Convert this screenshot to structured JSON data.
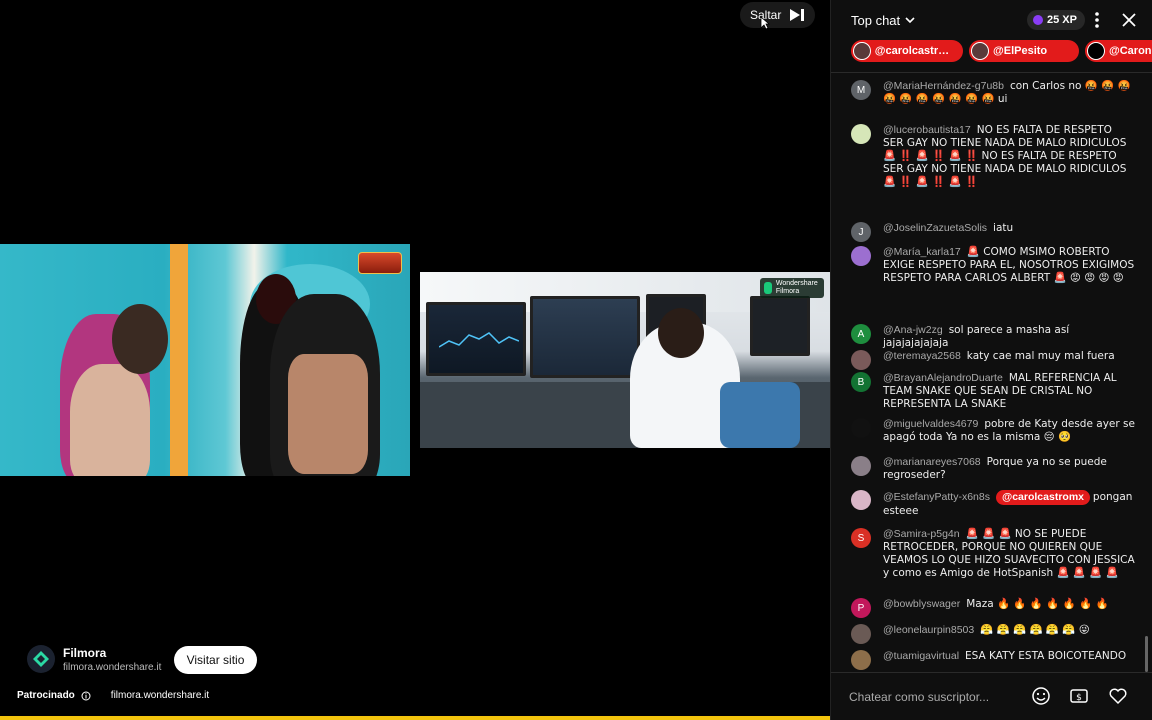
{
  "video": {
    "skip_label": "Saltar",
    "ad": {
      "name": "Filmora",
      "domain": "filmora.wondershare.it",
      "visit_label": "Visitar sitio",
      "sponsored_label": "Patrocinado",
      "sponsored_url": "filmora.wondershare.it",
      "progress": 1.0
    },
    "badge_text": "Wondershare Filmora",
    "colors": {
      "progress": "#f2c40d"
    }
  },
  "chat": {
    "title": "Top chat",
    "xp": "25 XP",
    "pinned": [
      {
        "label": "@carolcastro..."
      },
      {
        "label": "@ElPesito"
      },
      {
        "label": "@Caron"
      }
    ],
    "messages": [
      {
        "avatar_letter": "M",
        "avatar_color": "#5f6368",
        "author": "@MariaHernández-g7u8b",
        "text": "con Carlos no 🤬 🤬 🤬 🤬 🤬 🤬 🤬 🤬 🤬 🤬 ui"
      },
      {
        "avatar_letter": "",
        "avatar_color": "#d6e6b8",
        "author": "@lucerobautista17",
        "text": "NO ES FALTA DE RESPETO SER GAY NO TIENE NADA DE MALO RIDICULOS 🚨 ‼️ 🚨 ‼️ 🚨 ‼️ NO ES FALTA DE RESPETO SER GAY NO TIENE NADA DE MALO RIDICULOS 🚨 ‼️ 🚨 ‼️ 🚨 ‼️"
      },
      {
        "avatar_letter": "J",
        "avatar_color": "#5f6368",
        "author": "@JoselinZazuetaSolis",
        "text": "iatu"
      },
      {
        "avatar_letter": "",
        "avatar_color": "#9c6fd0",
        "author": "@María_karla17",
        "text": "🚨 COMO MSIMO ROBERTO EXIGE RESPETO PARA EL, NOSOTROS EXIGIMOS RESPETO PARA CARLOS ALBERT 🚨 😡 😡 😡 😡"
      },
      {
        "avatar_letter": "A",
        "avatar_color": "#1e8e3e",
        "author": "@Ana-jw2zg",
        "text": "sol parece a masha así jajajajajajaja"
      },
      {
        "avatar_letter": "",
        "avatar_color": "#7a5a5a",
        "author": "@teremaya2568",
        "text": "katy cae mal muy mal fuera"
      },
      {
        "avatar_letter": "B",
        "avatar_color": "#137333",
        "author": "@BrayanAlejandroDuarte",
        "text": "MAL REFERENCIA AL TEAM SNAKE QUE SEAN DE CRISTAL NO REPRESENTA LA SNAKE"
      },
      {
        "avatar_letter": "",
        "avatar_color": "#111111",
        "author": "@miguelvaldes4679",
        "text": "pobre de Katy desde ayer se apagó toda Ya no es la misma 😔 🥺"
      },
      {
        "avatar_letter": "",
        "avatar_color": "#8a7f88",
        "author": "@marianareyes7068",
        "text": "Porque ya no se puede regroseder?"
      },
      {
        "avatar_letter": "",
        "avatar_color": "#d9b6c7",
        "author": "@EstefanyPatty-x6n8s",
        "mention": "@carolcastromx",
        "text": "pongan esteee"
      },
      {
        "avatar_letter": "S",
        "avatar_color": "#d93025",
        "author": "@Samira-p5g4n",
        "text": "🚨 🚨 🚨 NO SE PUEDE RETROCEDER, PORQUE NO QUIEREN QUE VEAMOS LO QUE HIZO SUAVECITO CON JESSICA y como es Amigo de HotSpanish 🚨 🚨 🚨 🚨"
      },
      {
        "avatar_letter": "P",
        "avatar_color": "#c2185b",
        "author": "@bowblyswager",
        "text": "Maza 🔥 🔥 🔥 🔥 🔥 🔥 🔥"
      },
      {
        "avatar_letter": "",
        "avatar_color": "#6a5a55",
        "author": "@leonelaurpin8503",
        "text": "😤 😤 😤 😤 😤 😤 😜"
      },
      {
        "avatar_letter": "",
        "avatar_color": "#8d6e4a",
        "author": "@tuamigavirtual",
        "text": "ESA KATY ESTA BOICOTEANDO"
      }
    ],
    "input_placeholder": "Chatear como suscriptor..."
  }
}
